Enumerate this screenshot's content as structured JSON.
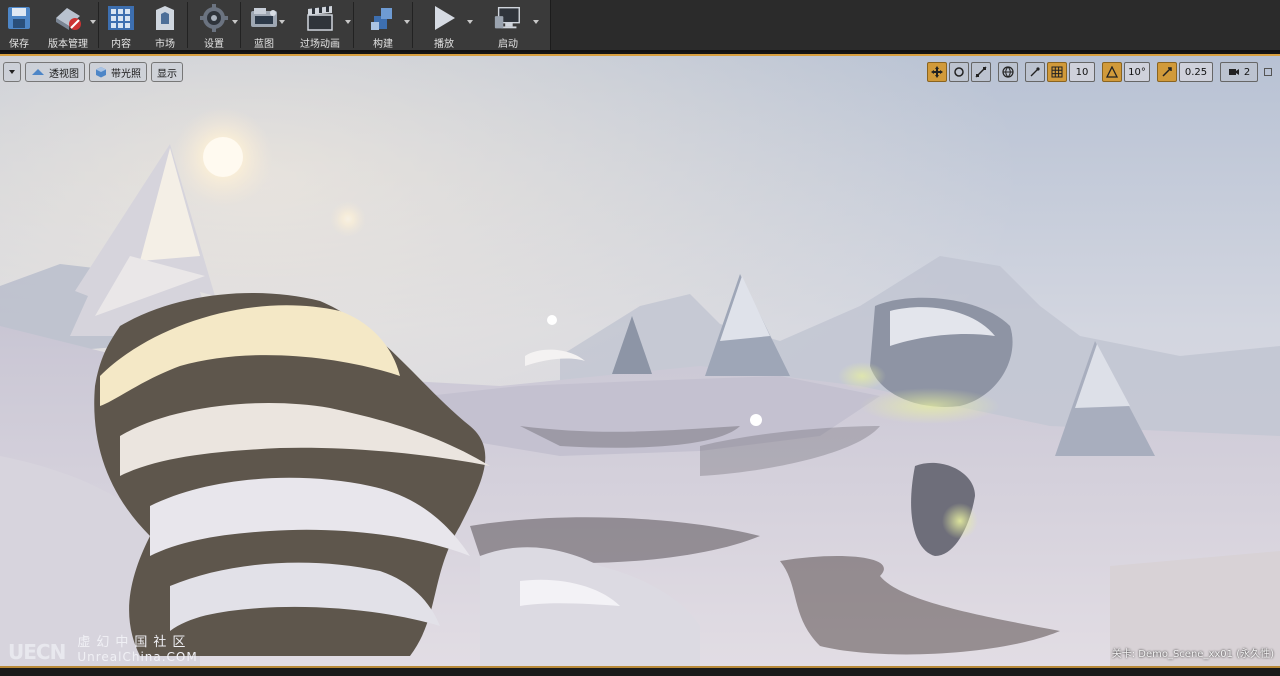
{
  "toolbar": {
    "items": [
      {
        "label": "保存",
        "icon": "save-icon",
        "caret": false
      },
      {
        "label": "版本管理",
        "icon": "source-control-icon",
        "caret": true
      },
      {
        "label": "内容",
        "icon": "content-icon",
        "caret": false
      },
      {
        "label": "市场",
        "icon": "marketplace-icon",
        "caret": false
      },
      {
        "label": "设置",
        "icon": "settings-icon",
        "caret": true
      },
      {
        "label": "蓝图",
        "icon": "blueprint-icon",
        "caret": true
      },
      {
        "label": "过场动画",
        "icon": "cinematics-icon",
        "caret": true
      },
      {
        "label": "构建",
        "icon": "build-icon",
        "caret": true
      },
      {
        "label": "播放",
        "icon": "play-icon",
        "caret": true
      },
      {
        "label": "启动",
        "icon": "launch-icon",
        "caret": true
      }
    ]
  },
  "viewport": {
    "left_controls": {
      "perspective": "透视图",
      "lit": "带光照",
      "show": "显示"
    },
    "right_controls": {
      "grid_snap": "10",
      "rotation_snap": "10°",
      "scale_snap": "0.25",
      "camera_speed": "2"
    },
    "level_label": "关卡: Demo_Scene_xx01 (永久性)"
  },
  "watermark": {
    "logo": "UECN",
    "chinese": "虚幻中国社区",
    "english": "UnrealChina.COM"
  },
  "colors": {
    "accent": "#d19a3a",
    "toolbar_bg": "#3a3a3a",
    "sky": "#c5cad8"
  }
}
